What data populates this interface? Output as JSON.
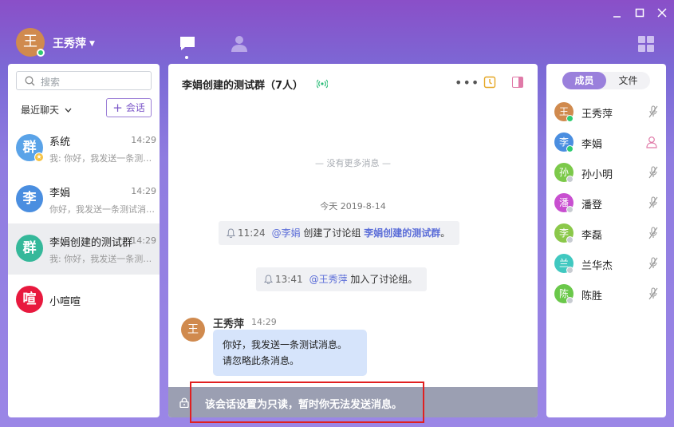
{
  "window": {
    "controls": [
      "minimize-icon",
      "maximize-icon",
      "close-icon"
    ],
    "accent": "#8a4fc8"
  },
  "user": {
    "avatar_char": "王",
    "name": "王秀萍",
    "status_color": "#2ecc71"
  },
  "nav": {
    "tabs": [
      {
        "name": "chat-icon",
        "active": true
      },
      {
        "name": "contacts-icon",
        "active": false
      }
    ],
    "apps_icon": "grid-icon"
  },
  "sidebar": {
    "search_placeholder": "搜索",
    "recent_label": "最近聊天",
    "new_chat_label": "会话",
    "chats": [
      {
        "avatar": "群",
        "color": "#5aa3e8",
        "name": "系统",
        "time": "14:29",
        "preview": "我: 你好，我发送一条测试消息。",
        "star": true
      },
      {
        "avatar": "李",
        "color": "#4a8ee0",
        "name": "李娟",
        "time": "14:29",
        "preview": "你好，我发送一条测试消息。请忽略此条消息。"
      },
      {
        "avatar": "群",
        "color": "#35b89a",
        "name": "李娟创建的测试群",
        "time": "14:29",
        "preview": "我: 你好，我发送一条测试消息。",
        "active": true
      },
      {
        "avatar": "喧",
        "color": "#e8193e",
        "name": "小喧喧",
        "time": "",
        "preview": ""
      }
    ]
  },
  "chat": {
    "title": "李娟创建的测试群（7人）",
    "no_more": "— 没有更多消息 —",
    "date": "今天 2019-8-14",
    "system_messages": [
      {
        "time": "11:24",
        "user": "@李娟",
        "action": " 创建了讨论组 ",
        "target": "李娟创建的测试群",
        "end": "。"
      },
      {
        "time": "13:41",
        "user": "@王秀萍",
        "action": " 加入了讨论组。",
        "target": "",
        "end": ""
      }
    ],
    "message": {
      "avatar": "王",
      "sender": "王秀萍",
      "time": "14:29",
      "line1": "你好，我发送一条测试消息。",
      "line2": "请忽略此条消息。"
    },
    "readonly_notice": "该会话设置为只读，暂时你无法发送消息。"
  },
  "members_panel": {
    "tab_members": "成员",
    "tab_files": "文件",
    "members": [
      {
        "avatar": "王",
        "color": "#d08a4e",
        "name": "王秀萍",
        "online": true,
        "role": "mic"
      },
      {
        "avatar": "李",
        "color": "#4a8ee0",
        "name": "李娟",
        "online": true,
        "role": "owner"
      },
      {
        "avatar": "孙",
        "color": "#7cc94a",
        "name": "孙小明",
        "online": false,
        "role": "mic"
      },
      {
        "avatar": "潘",
        "color": "#c84fd0",
        "name": "潘登",
        "online": false,
        "role": "mic"
      },
      {
        "avatar": "李",
        "color": "#8bc84a",
        "name": "李磊",
        "online": false,
        "role": "mic"
      },
      {
        "avatar": "兰",
        "color": "#40c8c0",
        "name": "兰华杰",
        "online": false,
        "role": "mic"
      },
      {
        "avatar": "陈",
        "color": "#6ac84a",
        "name": "陈胜",
        "online": false,
        "role": "mic"
      }
    ]
  }
}
